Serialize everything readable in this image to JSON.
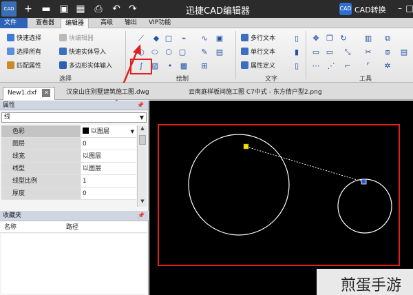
{
  "app": {
    "logo": "CAD",
    "title": "迅捷CAD编辑器",
    "convert_label": "CAD转换",
    "convert_icon": "cad-convert-icon",
    "quick_access_icons": [
      "new-icon",
      "open-icon",
      "save-icon",
      "print-icon",
      "undo-icon",
      "redo-icon"
    ],
    "window_controls": [
      "minimize-icon",
      "maximize-icon",
      "close-icon"
    ]
  },
  "menu": {
    "tabs": [
      "文件",
      "查看器",
      "编辑器",
      "高级",
      "输出",
      "VIP功能"
    ],
    "active": "编辑器"
  },
  "ribbon": {
    "select_group": {
      "label": "选择",
      "items": [
        "快速选择",
        "块编辑器",
        "选择所有",
        "快速实体导入",
        "匹配属性",
        "多边形实体输入"
      ]
    },
    "draw_group": {
      "label": "绘制"
    },
    "text_group": {
      "label": "文字",
      "items": [
        "多行文本",
        "单行文本",
        "属性定义"
      ]
    },
    "tools_group": {
      "label": "工具"
    }
  },
  "doctabs": {
    "tabs": [
      "New1.dxf",
      "汉泉山庄别墅建筑施工图.dwg",
      "云南庭样板间施工图 C7中式 - 东方倩户型2.png"
    ],
    "close_icon": "close-tab-icon"
  },
  "properties": {
    "title": "属性",
    "pin_icon": "pin-icon",
    "object_type": "线",
    "rows": [
      {
        "key": "色彩",
        "value": "以图层"
      },
      {
        "key": "图层",
        "value": "0"
      },
      {
        "key": "线宽",
        "value": "以图层"
      },
      {
        "key": "线型",
        "value": "以图层"
      },
      {
        "key": "线型比例",
        "value": "1"
      },
      {
        "key": "厚度",
        "value": "0"
      }
    ]
  },
  "favorites": {
    "title": "收藏夹",
    "columns": [
      "名称",
      "路径"
    ]
  },
  "watermark": "煎蛋手游",
  "colors": {
    "file_tab": "#2d63b6",
    "highlight": "#e02020",
    "grip_yellow": "#f2e200",
    "grip_blue": "#2b58e0"
  }
}
